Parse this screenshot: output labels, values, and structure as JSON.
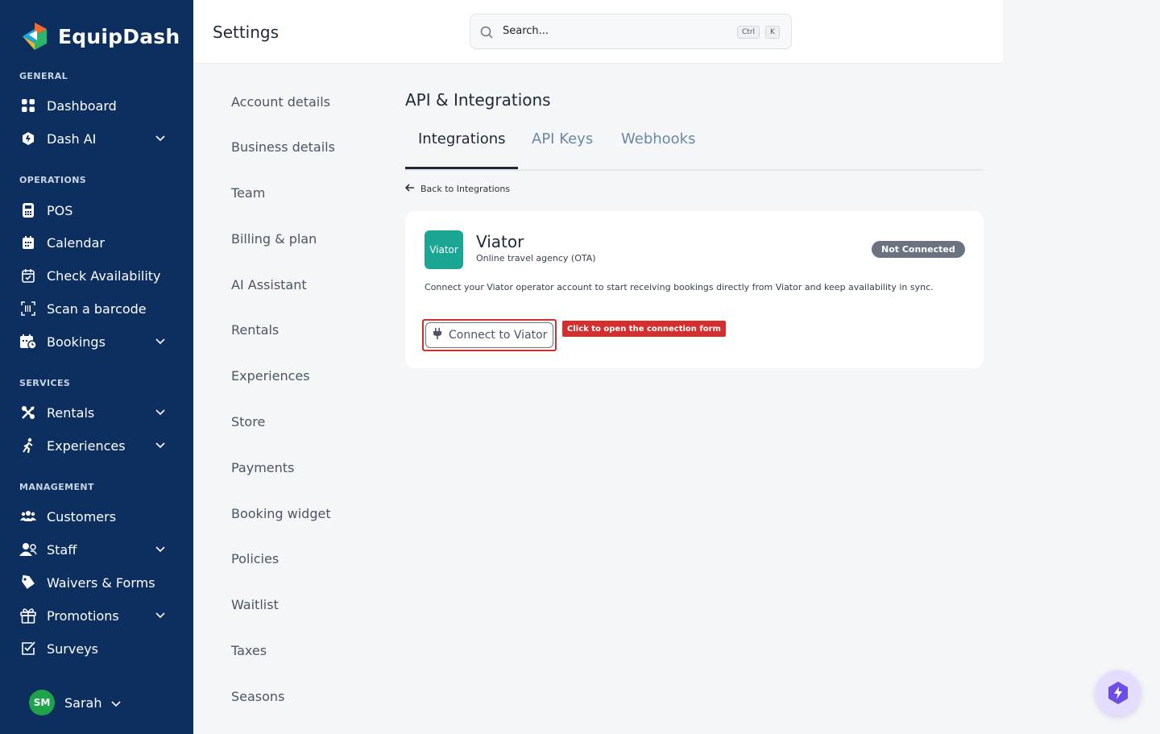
{
  "app": {
    "name": "EquipDash"
  },
  "sidebar": {
    "sections": [
      {
        "label": "GENERAL"
      },
      {
        "label": "OPERATIONS"
      },
      {
        "label": "SERVICES"
      },
      {
        "label": "MANAGEMENT"
      }
    ],
    "items": [
      {
        "label": "Dashboard",
        "icon": "grid-icon"
      },
      {
        "label": "Dash AI",
        "icon": "ai-shield-icon"
      },
      {
        "label": "POS",
        "icon": "pos-terminal-icon"
      },
      {
        "label": "Calendar",
        "icon": "calendar-icon"
      },
      {
        "label": "Check Availability",
        "icon": "calendar-check-icon"
      },
      {
        "label": "Scan a barcode",
        "icon": "barcode-icon"
      },
      {
        "label": "Bookings",
        "icon": "bookings-icon"
      },
      {
        "label": "Rentals",
        "icon": "rentals-icon"
      },
      {
        "label": "Experiences",
        "icon": "experiences-icon"
      },
      {
        "label": "Customers",
        "icon": "customers-icon"
      },
      {
        "label": "Staff",
        "icon": "staff-icon"
      },
      {
        "label": "Waivers & Forms",
        "icon": "tag-icon"
      },
      {
        "label": "Promotions",
        "icon": "gift-icon"
      },
      {
        "label": "Surveys",
        "icon": "survey-icon"
      }
    ],
    "user": {
      "initials": "SM",
      "name": "Sarah"
    }
  },
  "topbar": {
    "title": "Settings",
    "search_placeholder": "Search...",
    "shortcut_ctrl": "Ctrl",
    "shortcut_key": "K"
  },
  "settings_menu": [
    "Account details",
    "Business details",
    "Team",
    "Billing & plan",
    "AI Assistant",
    "Rentals",
    "Experiences",
    "Store",
    "Payments",
    "Booking widget",
    "Policies",
    "Waitlist",
    "Taxes",
    "Seasons"
  ],
  "content": {
    "title": "API & Integrations",
    "tabs": [
      "Integrations",
      "API Keys",
      "Webhooks"
    ],
    "back_label": "Back to Integrations",
    "integration": {
      "logo_text": "Viator",
      "name": "Viator",
      "subtitle": "Online travel agency (OTA)",
      "status": "Not Connected",
      "description": "Connect your Viator operator account to start receiving bookings directly from Viator and keep availability in sync.",
      "connect_label": "Connect to Viator",
      "tooltip": "Click to open the connection form"
    }
  },
  "colors": {
    "sidebar_bg": "#0c2f5f",
    "viator_green": "#1aa692",
    "status_gray": "#6b7280",
    "highlight_red": "#d32f2f",
    "avatar_green": "#1fa34a"
  }
}
